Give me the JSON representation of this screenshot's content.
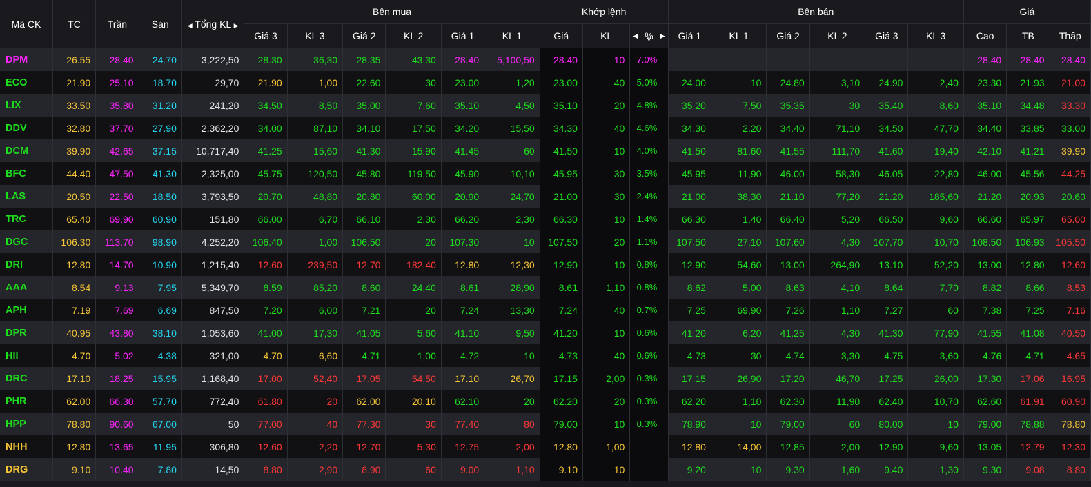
{
  "header": {
    "ma_ck": "Mã CK",
    "tc": "TC",
    "tran": "Trần",
    "san": "Sàn",
    "tong_kl": "Tổng KL",
    "ben_mua": "Bên mua",
    "khop_lenh": "Khớp lệnh",
    "ben_ban": "Bên bán",
    "gia": "Giá",
    "gia3": "Giá 3",
    "kl3": "KL 3",
    "gia2": "Giá 2",
    "kl2": "KL 2",
    "gia1": "Giá 1",
    "kl1": "KL 1",
    "khop_gia": "Giá",
    "khop_kl": "KL",
    "pct": "%",
    "cao": "Cao",
    "tb": "TB",
    "thap": "Thấp"
  },
  "icons": {
    "left": "◀",
    "right": "▶",
    "sort_down": "▼"
  },
  "colors": {
    "ref": "#f5c535",
    "ceil": "#ff25ff",
    "floor": "#22d6f0",
    "up": "#1dde1d",
    "down": "#ff3737"
  },
  "rows": [
    {
      "sym": "DPM",
      "sc": "ceil",
      "tc": "26.55",
      "tran": "28.40",
      "san": "24.70",
      "tong": "3,222,50",
      "b3": [
        "28.30",
        "up"
      ],
      "bk3": "36,30",
      "b2": [
        "28.35",
        "up"
      ],
      "bk2": "43,30",
      "b1": [
        "28.40",
        "ceil"
      ],
      "bk1": "5,100,50",
      "mp": [
        "28.40",
        "ceil"
      ],
      "mk": "10",
      "pct": "7.0%",
      "s1": [
        "",
        ""
      ],
      "sk1": "",
      "s2": [
        "",
        ""
      ],
      "sk2": "",
      "s3": [
        "",
        ""
      ],
      "sk3": "",
      "cao": [
        "28.40",
        "ceil"
      ],
      "tb": [
        "28.40",
        "ceil"
      ],
      "thap": [
        "28.40",
        "ceil"
      ]
    },
    {
      "sym": "ECO",
      "sc": "up",
      "tc": "21.90",
      "tran": "25.10",
      "san": "18.70",
      "tong": "29,70",
      "b3": [
        "21.90",
        "ref"
      ],
      "bk3": "1,00",
      "b2": [
        "22.60",
        "up"
      ],
      "bk2": "30",
      "b1": [
        "23.00",
        "up"
      ],
      "bk1": "1,20",
      "mp": [
        "23.00",
        "up"
      ],
      "mk": "40",
      "pct": "5.0%",
      "s1": [
        "24.00",
        "up"
      ],
      "sk1": "10",
      "s2": [
        "24.80",
        "up"
      ],
      "sk2": "3,10",
      "s3": [
        "24.90",
        "up"
      ],
      "sk3": "2,40",
      "cao": [
        "23.30",
        "up"
      ],
      "tb": [
        "21.93",
        "up"
      ],
      "thap": [
        "21.00",
        "down"
      ]
    },
    {
      "sym": "LIX",
      "sc": "up",
      "tc": "33.50",
      "tran": "35.80",
      "san": "31.20",
      "tong": "241,20",
      "b3": [
        "34.50",
        "up"
      ],
      "bk3": "8,50",
      "b2": [
        "35.00",
        "up"
      ],
      "bk2": "7,60",
      "b1": [
        "35.10",
        "up"
      ],
      "bk1": "4,50",
      "mp": [
        "35.10",
        "up"
      ],
      "mk": "20",
      "pct": "4.8%",
      "s1": [
        "35.20",
        "up"
      ],
      "sk1": "7,50",
      "s2": [
        "35.35",
        "up"
      ],
      "sk2": "30",
      "s3": [
        "35.40",
        "up"
      ],
      "sk3": "8,60",
      "cao": [
        "35.10",
        "up"
      ],
      "tb": [
        "34.48",
        "up"
      ],
      "thap": [
        "33.30",
        "down"
      ]
    },
    {
      "sym": "DDV",
      "sc": "up",
      "tc": "32.80",
      "tran": "37.70",
      "san": "27.90",
      "tong": "2,362,20",
      "b3": [
        "34.00",
        "up"
      ],
      "bk3": "87,10",
      "b2": [
        "34.10",
        "up"
      ],
      "bk2": "17,50",
      "b1": [
        "34.20",
        "up"
      ],
      "bk1": "15,50",
      "mp": [
        "34.30",
        "up"
      ],
      "mk": "40",
      "pct": "4.6%",
      "s1": [
        "34.30",
        "up"
      ],
      "sk1": "2,20",
      "s2": [
        "34.40",
        "up"
      ],
      "sk2": "71,10",
      "s3": [
        "34.50",
        "up"
      ],
      "sk3": "47,70",
      "cao": [
        "34.40",
        "up"
      ],
      "tb": [
        "33.85",
        "up"
      ],
      "thap": [
        "33.00",
        "up"
      ]
    },
    {
      "sym": "DCM",
      "sc": "up",
      "tc": "39.90",
      "tran": "42.65",
      "san": "37.15",
      "tong": "10,717,40",
      "b3": [
        "41.25",
        "up"
      ],
      "bk3": "15,60",
      "b2": [
        "41.30",
        "up"
      ],
      "bk2": "15,90",
      "b1": [
        "41.45",
        "up"
      ],
      "bk1": "60",
      "mp": [
        "41.50",
        "up"
      ],
      "mk": "10",
      "pct": "4.0%",
      "s1": [
        "41.50",
        "up"
      ],
      "sk1": "81,60",
      "s2": [
        "41.55",
        "up"
      ],
      "sk2": "111,70",
      "s3": [
        "41.60",
        "up"
      ],
      "sk3": "19,40",
      "cao": [
        "42.10",
        "up"
      ],
      "tb": [
        "41.21",
        "up"
      ],
      "thap": [
        "39.90",
        "ref"
      ]
    },
    {
      "sym": "BFC",
      "sc": "up",
      "tc": "44.40",
      "tran": "47.50",
      "san": "41.30",
      "tong": "2,325,00",
      "b3": [
        "45.75",
        "up"
      ],
      "bk3": "120,50",
      "b2": [
        "45.80",
        "up"
      ],
      "bk2": "119,50",
      "b1": [
        "45.90",
        "up"
      ],
      "bk1": "10,10",
      "mp": [
        "45.95",
        "up"
      ],
      "mk": "30",
      "pct": "3.5%",
      "s1": [
        "45.95",
        "up"
      ],
      "sk1": "11,90",
      "s2": [
        "46.00",
        "up"
      ],
      "sk2": "58,30",
      "s3": [
        "46.05",
        "up"
      ],
      "sk3": "22,80",
      "cao": [
        "46.00",
        "up"
      ],
      "tb": [
        "45.56",
        "up"
      ],
      "thap": [
        "44.25",
        "down"
      ]
    },
    {
      "sym": "LAS",
      "sc": "up",
      "tc": "20.50",
      "tran": "22.50",
      "san": "18.50",
      "tong": "3,793,50",
      "b3": [
        "20.70",
        "up"
      ],
      "bk3": "48,80",
      "b2": [
        "20.80",
        "up"
      ],
      "bk2": "60,00",
      "b1": [
        "20.90",
        "up"
      ],
      "bk1": "24,70",
      "mp": [
        "21.00",
        "up"
      ],
      "mk": "30",
      "pct": "2.4%",
      "s1": [
        "21.00",
        "up"
      ],
      "sk1": "38,30",
      "s2": [
        "21.10",
        "up"
      ],
      "sk2": "77,20",
      "s3": [
        "21.20",
        "up"
      ],
      "sk3": "185,60",
      "cao": [
        "21.20",
        "up"
      ],
      "tb": [
        "20.93",
        "up"
      ],
      "thap": [
        "20.60",
        "up"
      ]
    },
    {
      "sym": "TRC",
      "sc": "up",
      "tc": "65.40",
      "tran": "69.90",
      "san": "60.90",
      "tong": "151,80",
      "b3": [
        "66.00",
        "up"
      ],
      "bk3": "6,70",
      "b2": [
        "66.10",
        "up"
      ],
      "bk2": "2,30",
      "b1": [
        "66.20",
        "up"
      ],
      "bk1": "2,30",
      "mp": [
        "66.30",
        "up"
      ],
      "mk": "10",
      "pct": "1.4%",
      "s1": [
        "66.30",
        "up"
      ],
      "sk1": "1,40",
      "s2": [
        "66.40",
        "up"
      ],
      "sk2": "5,20",
      "s3": [
        "66.50",
        "up"
      ],
      "sk3": "9,60",
      "cao": [
        "66.60",
        "up"
      ],
      "tb": [
        "65.97",
        "up"
      ],
      "thap": [
        "65.00",
        "down"
      ]
    },
    {
      "sym": "DGC",
      "sc": "up",
      "tc": "106.30",
      "tran": "113.70",
      "san": "98.90",
      "tong": "4,252,20",
      "b3": [
        "106.40",
        "up"
      ],
      "bk3": "1,00",
      "b2": [
        "106.50",
        "up"
      ],
      "bk2": "20",
      "b1": [
        "107.30",
        "up"
      ],
      "bk1": "10",
      "mp": [
        "107.50",
        "up"
      ],
      "mk": "20",
      "pct": "1.1%",
      "s1": [
        "107.50",
        "up"
      ],
      "sk1": "27,10",
      "s2": [
        "107.60",
        "up"
      ],
      "sk2": "4,30",
      "s3": [
        "107.70",
        "up"
      ],
      "sk3": "10,70",
      "cao": [
        "108.50",
        "up"
      ],
      "tb": [
        "106.93",
        "up"
      ],
      "thap": [
        "105.50",
        "down"
      ]
    },
    {
      "sym": "DRI",
      "sc": "up",
      "tc": "12.80",
      "tran": "14.70",
      "san": "10.90",
      "tong": "1,215,40",
      "b3": [
        "12.60",
        "down"
      ],
      "bk3": "239,50",
      "b2": [
        "12.70",
        "down"
      ],
      "bk2": "182,40",
      "b1": [
        "12.80",
        "ref"
      ],
      "bk1": "12,30",
      "mp": [
        "12.90",
        "up"
      ],
      "mk": "10",
      "pct": "0.8%",
      "s1": [
        "12.90",
        "up"
      ],
      "sk1": "54,60",
      "s2": [
        "13.00",
        "up"
      ],
      "sk2": "264,90",
      "s3": [
        "13.10",
        "up"
      ],
      "sk3": "52,20",
      "cao": [
        "13.00",
        "up"
      ],
      "tb": [
        "12.80",
        "up"
      ],
      "thap": [
        "12.60",
        "down"
      ]
    },
    {
      "sym": "AAA",
      "sc": "up",
      "tc": "8.54",
      "tran": "9.13",
      "san": "7.95",
      "tong": "5,349,70",
      "b3": [
        "8.59",
        "up"
      ],
      "bk3": "85,20",
      "b2": [
        "8.60",
        "up"
      ],
      "bk2": "24,40",
      "b1": [
        "8.61",
        "up"
      ],
      "bk1": "28,90",
      "mp": [
        "8.61",
        "up"
      ],
      "mk": "1,10",
      "pct": "0.8%",
      "s1": [
        "8.62",
        "up"
      ],
      "sk1": "5,00",
      "s2": [
        "8.63",
        "up"
      ],
      "sk2": "4,10",
      "s3": [
        "8.64",
        "up"
      ],
      "sk3": "7,70",
      "cao": [
        "8.82",
        "up"
      ],
      "tb": [
        "8.66",
        "up"
      ],
      "thap": [
        "8.53",
        "down"
      ]
    },
    {
      "sym": "APH",
      "sc": "up",
      "tc": "7.19",
      "tran": "7.69",
      "san": "6.69",
      "tong": "847,50",
      "b3": [
        "7.20",
        "up"
      ],
      "bk3": "6,00",
      "b2": [
        "7.21",
        "up"
      ],
      "bk2": "20",
      "b1": [
        "7.24",
        "up"
      ],
      "bk1": "13,30",
      "mp": [
        "7.24",
        "up"
      ],
      "mk": "40",
      "pct": "0.7%",
      "s1": [
        "7.25",
        "up"
      ],
      "sk1": "69,90",
      "s2": [
        "7.26",
        "up"
      ],
      "sk2": "1,10",
      "s3": [
        "7.27",
        "up"
      ],
      "sk3": "60",
      "cao": [
        "7.38",
        "up"
      ],
      "tb": [
        "7.25",
        "up"
      ],
      "thap": [
        "7.16",
        "down"
      ]
    },
    {
      "sym": "DPR",
      "sc": "up",
      "tc": "40.95",
      "tran": "43.80",
      "san": "38.10",
      "tong": "1,053,60",
      "b3": [
        "41.00",
        "up"
      ],
      "bk3": "17,30",
      "b2": [
        "41.05",
        "up"
      ],
      "bk2": "5,60",
      "b1": [
        "41.10",
        "up"
      ],
      "bk1": "9,50",
      "mp": [
        "41.20",
        "up"
      ],
      "mk": "10",
      "pct": "0.6%",
      "s1": [
        "41.20",
        "up"
      ],
      "sk1": "6,20",
      "s2": [
        "41.25",
        "up"
      ],
      "sk2": "4,30",
      "s3": [
        "41.30",
        "up"
      ],
      "sk3": "77,90",
      "cao": [
        "41.55",
        "up"
      ],
      "tb": [
        "41.08",
        "up"
      ],
      "thap": [
        "40.50",
        "down"
      ]
    },
    {
      "sym": "HII",
      "sc": "up",
      "tc": "4.70",
      "tran": "5.02",
      "san": "4.38",
      "tong": "321,00",
      "b3": [
        "4.70",
        "ref"
      ],
      "bk3": "6,60",
      "b2": [
        "4.71",
        "up"
      ],
      "bk2": "1,00",
      "b1": [
        "4.72",
        "up"
      ],
      "bk1": "10",
      "mp": [
        "4.73",
        "up"
      ],
      "mk": "40",
      "pct": "0.6%",
      "s1": [
        "4.73",
        "up"
      ],
      "sk1": "30",
      "s2": [
        "4.74",
        "up"
      ],
      "sk2": "3,30",
      "s3": [
        "4.75",
        "up"
      ],
      "sk3": "3,60",
      "cao": [
        "4.76",
        "up"
      ],
      "tb": [
        "4.71",
        "up"
      ],
      "thap": [
        "4.65",
        "down"
      ]
    },
    {
      "sym": "DRC",
      "sc": "up",
      "tc": "17.10",
      "tran": "18.25",
      "san": "15.95",
      "tong": "1,168,40",
      "b3": [
        "17.00",
        "down"
      ],
      "bk3": "52,40",
      "b2": [
        "17.05",
        "down"
      ],
      "bk2": "54,50",
      "b1": [
        "17.10",
        "ref"
      ],
      "bk1": "26,70",
      "mp": [
        "17.15",
        "up"
      ],
      "mk": "2,00",
      "pct": "0.3%",
      "s1": [
        "17.15",
        "up"
      ],
      "sk1": "26,90",
      "s2": [
        "17.20",
        "up"
      ],
      "sk2": "46,70",
      "s3": [
        "17.25",
        "up"
      ],
      "sk3": "26,00",
      "cao": [
        "17.30",
        "up"
      ],
      "tb": [
        "17.06",
        "down"
      ],
      "thap": [
        "16.95",
        "down"
      ]
    },
    {
      "sym": "PHR",
      "sc": "up",
      "tc": "62.00",
      "tran": "66.30",
      "san": "57.70",
      "tong": "772,40",
      "b3": [
        "61.80",
        "down"
      ],
      "bk3": "20",
      "b2": [
        "62.00",
        "ref"
      ],
      "bk2": "20,10",
      "b1": [
        "62.10",
        "up"
      ],
      "bk1": "20",
      "mp": [
        "62.20",
        "up"
      ],
      "mk": "20",
      "pct": "0.3%",
      "s1": [
        "62.20",
        "up"
      ],
      "sk1": "1,10",
      "s2": [
        "62.30",
        "up"
      ],
      "sk2": "11,90",
      "s3": [
        "62.40",
        "up"
      ],
      "sk3": "10,70",
      "cao": [
        "62.60",
        "up"
      ],
      "tb": [
        "61.91",
        "down"
      ],
      "thap": [
        "60.90",
        "down"
      ]
    },
    {
      "sym": "HPP",
      "sc": "up",
      "tc": "78.80",
      "tran": "90.60",
      "san": "67.00",
      "tong": "50",
      "b3": [
        "77.00",
        "down"
      ],
      "bk3": "40",
      "b2": [
        "77.30",
        "down"
      ],
      "bk2": "30",
      "b1": [
        "77.40",
        "down"
      ],
      "bk1": "80",
      "mp": [
        "79.00",
        "up"
      ],
      "mk": "10",
      "pct": "0.3%",
      "s1": [
        "78.90",
        "up"
      ],
      "sk1": "10",
      "s2": [
        "79.00",
        "up"
      ],
      "sk2": "60",
      "s3": [
        "80.00",
        "up"
      ],
      "sk3": "10",
      "cao": [
        "79.00",
        "up"
      ],
      "tb": [
        "78.88",
        "up"
      ],
      "thap": [
        "78.80",
        "ref"
      ]
    },
    {
      "sym": "NHH",
      "sc": "ref",
      "tc": "12.80",
      "tran": "13.65",
      "san": "11.95",
      "tong": "306,80",
      "b3": [
        "12.60",
        "down"
      ],
      "bk3": "2,20",
      "b2": [
        "12.70",
        "down"
      ],
      "bk2": "5,30",
      "b1": [
        "12.75",
        "down"
      ],
      "bk1": "2,00",
      "mp": [
        "12.80",
        "ref"
      ],
      "mk": "1,00",
      "pct": "",
      "s1": [
        "12.80",
        "ref"
      ],
      "sk1": "14,00",
      "s2": [
        "12.85",
        "up"
      ],
      "sk2": "2,00",
      "s3": [
        "12.90",
        "up"
      ],
      "sk3": "9,60",
      "cao": [
        "13.05",
        "up"
      ],
      "tb": [
        "12.79",
        "down"
      ],
      "thap": [
        "12.30",
        "down"
      ]
    },
    {
      "sym": "DRG",
      "sc": "ref",
      "tc": "9.10",
      "tran": "10.40",
      "san": "7.80",
      "tong": "14,50",
      "b3": [
        "8.80",
        "down"
      ],
      "bk3": "2,90",
      "b2": [
        "8.90",
        "down"
      ],
      "bk2": "60",
      "b1": [
        "9.00",
        "down"
      ],
      "bk1": "1,10",
      "mp": [
        "9.10",
        "ref"
      ],
      "mk": "10",
      "pct": "",
      "s1": [
        "9.20",
        "up"
      ],
      "sk1": "10",
      "s2": [
        "9.30",
        "up"
      ],
      "sk2": "1,60",
      "s3": [
        "9.40",
        "up"
      ],
      "sk3": "1,30",
      "cao": [
        "9.30",
        "up"
      ],
      "tb": [
        "9.08",
        "down"
      ],
      "thap": [
        "8.80",
        "down"
      ]
    }
  ]
}
